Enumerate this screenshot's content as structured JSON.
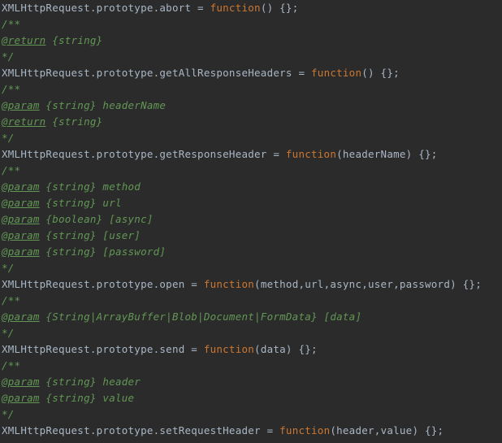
{
  "editor": {
    "theme_name": "darcula",
    "colors": {
      "background": "#2b2b2b",
      "code_text": "#a9b7c6",
      "keyword": "#cc7832",
      "comment": "#629755"
    },
    "lines": [
      {
        "kind": "code",
        "tokens": [
          {
            "type": "plain",
            "text": "XMLHttpRequest.prototype.abort = "
          },
          {
            "type": "keyword",
            "text": "function"
          },
          {
            "type": "plain",
            "text": "() {};"
          }
        ]
      },
      {
        "kind": "comment",
        "tokens": [
          {
            "type": "delim",
            "text": "/**"
          }
        ]
      },
      {
        "kind": "comment",
        "tokens": [
          {
            "type": "tag",
            "text": "@return"
          },
          {
            "type": "type",
            "text": " {string}"
          }
        ]
      },
      {
        "kind": "comment",
        "tokens": [
          {
            "type": "delim",
            "text": "*/"
          }
        ]
      },
      {
        "kind": "code",
        "tokens": [
          {
            "type": "plain",
            "text": "XMLHttpRequest.prototype.getAllResponseHeaders = "
          },
          {
            "type": "keyword",
            "text": "function"
          },
          {
            "type": "plain",
            "text": "() {};"
          }
        ]
      },
      {
        "kind": "comment",
        "tokens": [
          {
            "type": "delim",
            "text": "/**"
          }
        ]
      },
      {
        "kind": "comment",
        "tokens": [
          {
            "type": "tag",
            "text": "@param"
          },
          {
            "type": "type",
            "text": " {string}"
          },
          {
            "type": "name",
            "text": " headerName"
          }
        ]
      },
      {
        "kind": "comment",
        "tokens": [
          {
            "type": "tag",
            "text": "@return"
          },
          {
            "type": "type",
            "text": " {string}"
          }
        ]
      },
      {
        "kind": "comment",
        "tokens": [
          {
            "type": "delim",
            "text": "*/"
          }
        ]
      },
      {
        "kind": "code",
        "tokens": [
          {
            "type": "plain",
            "text": "XMLHttpRequest.prototype.getResponseHeader = "
          },
          {
            "type": "keyword",
            "text": "function"
          },
          {
            "type": "plain",
            "text": "(headerName) {};"
          }
        ]
      },
      {
        "kind": "comment",
        "tokens": [
          {
            "type": "delim",
            "text": "/**"
          }
        ]
      },
      {
        "kind": "comment",
        "tokens": [
          {
            "type": "tag",
            "text": "@param"
          },
          {
            "type": "type",
            "text": " {string}"
          },
          {
            "type": "name",
            "text": " method"
          }
        ]
      },
      {
        "kind": "comment",
        "tokens": [
          {
            "type": "tag",
            "text": "@param"
          },
          {
            "type": "type",
            "text": " {string}"
          },
          {
            "type": "name",
            "text": " url"
          }
        ]
      },
      {
        "kind": "comment",
        "tokens": [
          {
            "type": "tag",
            "text": "@param"
          },
          {
            "type": "type",
            "text": " {boolean}"
          },
          {
            "type": "name",
            "text": " [async]"
          }
        ]
      },
      {
        "kind": "comment",
        "tokens": [
          {
            "type": "tag",
            "text": "@param"
          },
          {
            "type": "type",
            "text": " {string}"
          },
          {
            "type": "name",
            "text": " [user]"
          }
        ]
      },
      {
        "kind": "comment",
        "tokens": [
          {
            "type": "tag",
            "text": "@param"
          },
          {
            "type": "type",
            "text": " {string}"
          },
          {
            "type": "name",
            "text": " [password]"
          }
        ]
      },
      {
        "kind": "comment",
        "tokens": [
          {
            "type": "delim",
            "text": "*/"
          }
        ]
      },
      {
        "kind": "code",
        "tokens": [
          {
            "type": "plain",
            "text": "XMLHttpRequest.prototype.open = "
          },
          {
            "type": "keyword",
            "text": "function"
          },
          {
            "type": "plain",
            "text": "(method,url,async,user,password) {};"
          }
        ]
      },
      {
        "kind": "comment",
        "tokens": [
          {
            "type": "delim",
            "text": "/**"
          }
        ]
      },
      {
        "kind": "comment",
        "tokens": [
          {
            "type": "tag",
            "text": "@param"
          },
          {
            "type": "type",
            "text": " {String|ArrayBuffer|Blob|Document|FormData}"
          },
          {
            "type": "name",
            "text": " [data]"
          }
        ]
      },
      {
        "kind": "comment",
        "tokens": [
          {
            "type": "delim",
            "text": "*/"
          }
        ]
      },
      {
        "kind": "code",
        "tokens": [
          {
            "type": "plain",
            "text": "XMLHttpRequest.prototype.send = "
          },
          {
            "type": "keyword",
            "text": "function"
          },
          {
            "type": "plain",
            "text": "(data) {};"
          }
        ]
      },
      {
        "kind": "comment",
        "tokens": [
          {
            "type": "delim",
            "text": "/**"
          }
        ]
      },
      {
        "kind": "comment",
        "tokens": [
          {
            "type": "tag",
            "text": "@param"
          },
          {
            "type": "type",
            "text": " {string}"
          },
          {
            "type": "name",
            "text": " header"
          }
        ]
      },
      {
        "kind": "comment",
        "tokens": [
          {
            "type": "tag",
            "text": "@param"
          },
          {
            "type": "type",
            "text": " {string}"
          },
          {
            "type": "name",
            "text": " value"
          }
        ]
      },
      {
        "kind": "comment",
        "tokens": [
          {
            "type": "delim",
            "text": "*/"
          }
        ]
      },
      {
        "kind": "code",
        "tokens": [
          {
            "type": "plain",
            "text": "XMLHttpRequest.prototype.setRequestHeader = "
          },
          {
            "type": "keyword",
            "text": "function"
          },
          {
            "type": "plain",
            "text": "(header,value) {};"
          }
        ]
      }
    ]
  }
}
